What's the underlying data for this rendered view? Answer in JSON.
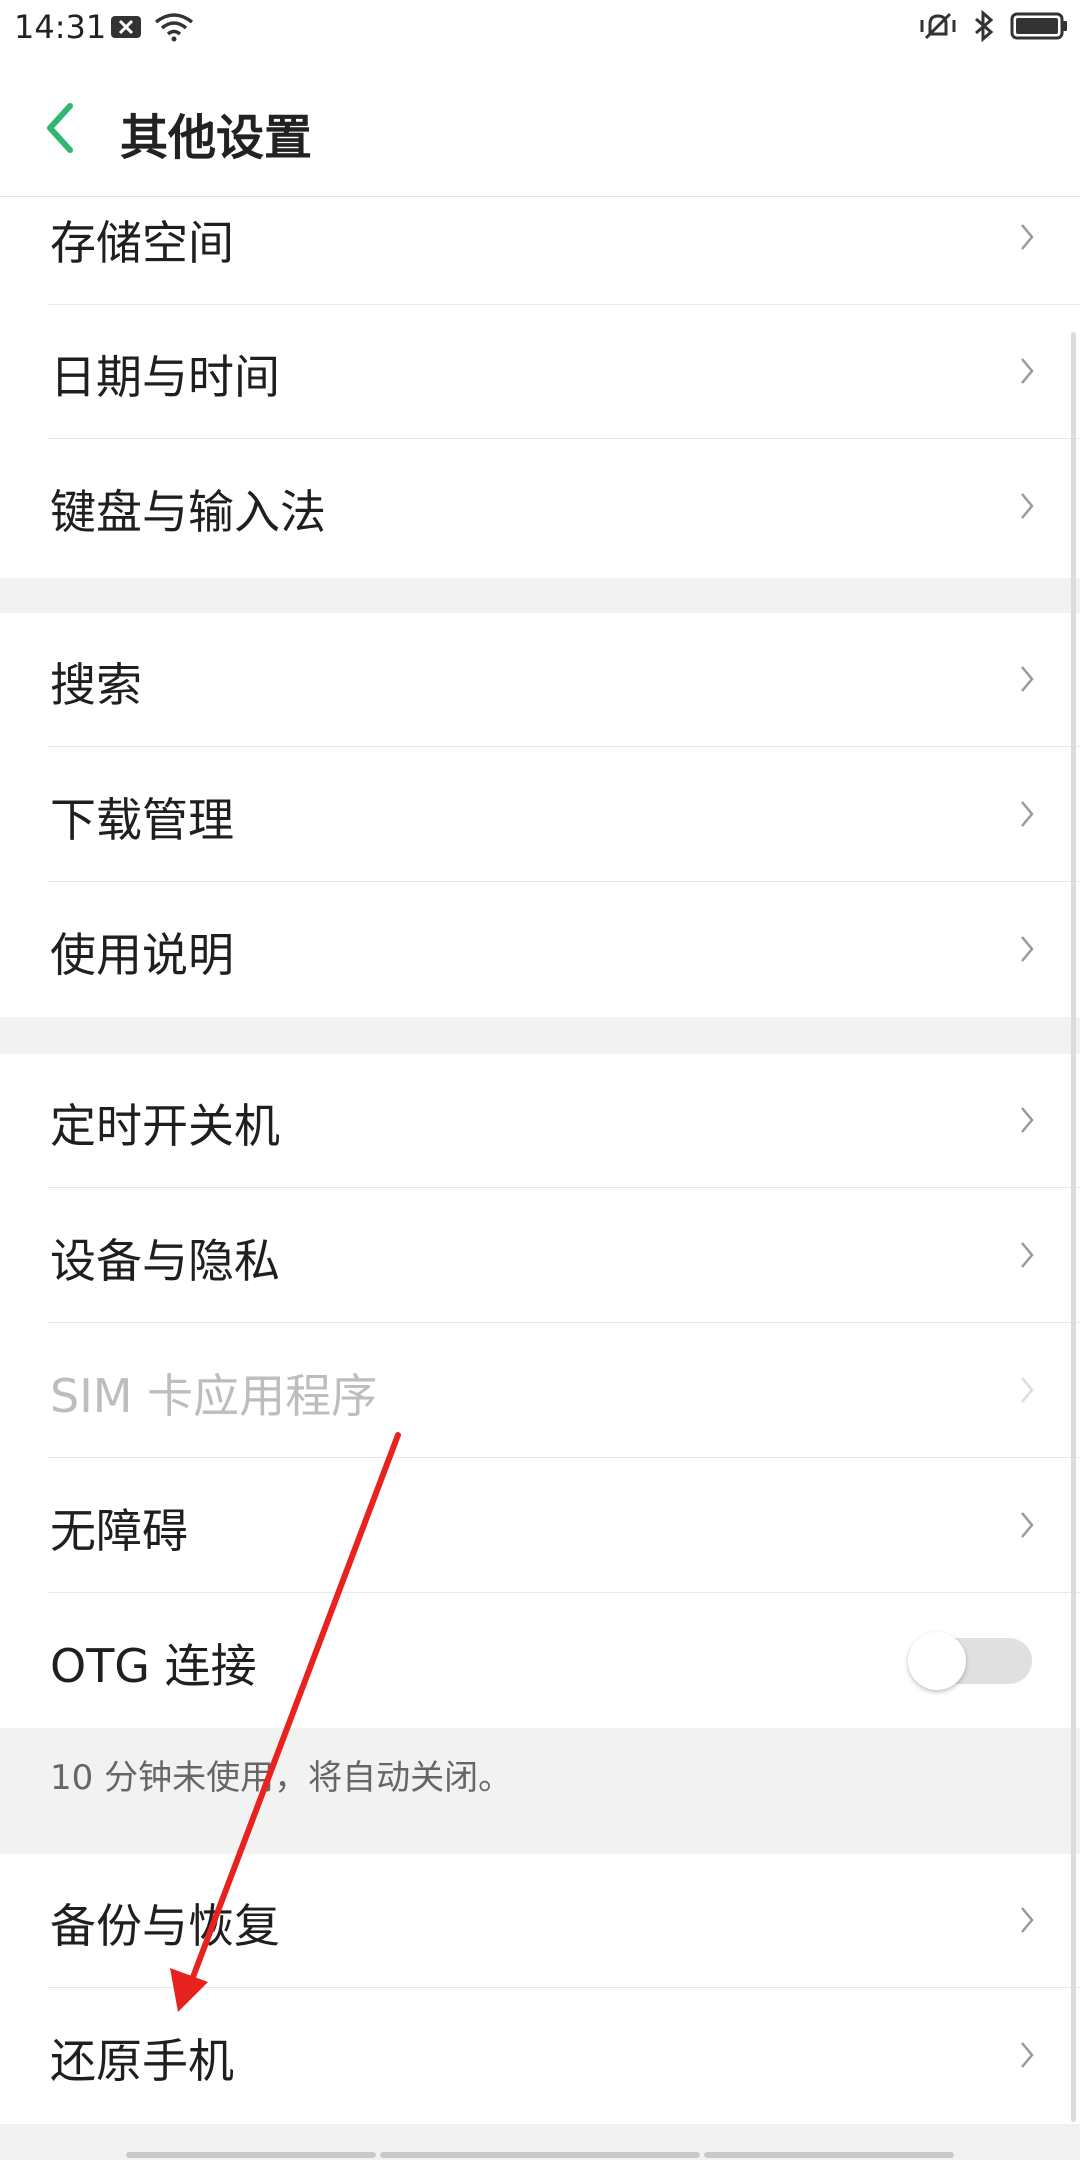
{
  "status_bar": {
    "time": "14:31",
    "icons": [
      "notification-x-icon",
      "wifi-icon",
      "vibrate-icon",
      "bluetooth-icon",
      "battery-icon"
    ]
  },
  "header": {
    "title": "其他设置"
  },
  "groups": {
    "storage": {
      "items": [
        "存储空间",
        "日期与时间",
        "键盘与输入法"
      ]
    },
    "search": {
      "items": [
        "搜索",
        "下载管理",
        "使用说明"
      ]
    },
    "system": {
      "items": [
        "定时开关机",
        "设备与隐私",
        "SIM 卡应用程序",
        "无障碍",
        "OTG 连接"
      ],
      "otg_note": "10 分钟未使用，将自动关闭。"
    },
    "backup": {
      "items": [
        "备份与恢复",
        "还原手机"
      ]
    }
  },
  "otg_toggle": {
    "on": false
  },
  "colors": {
    "accent": "#2fb86e",
    "arrow": "#e8231f",
    "disabled_text": "#bdbdbd"
  }
}
